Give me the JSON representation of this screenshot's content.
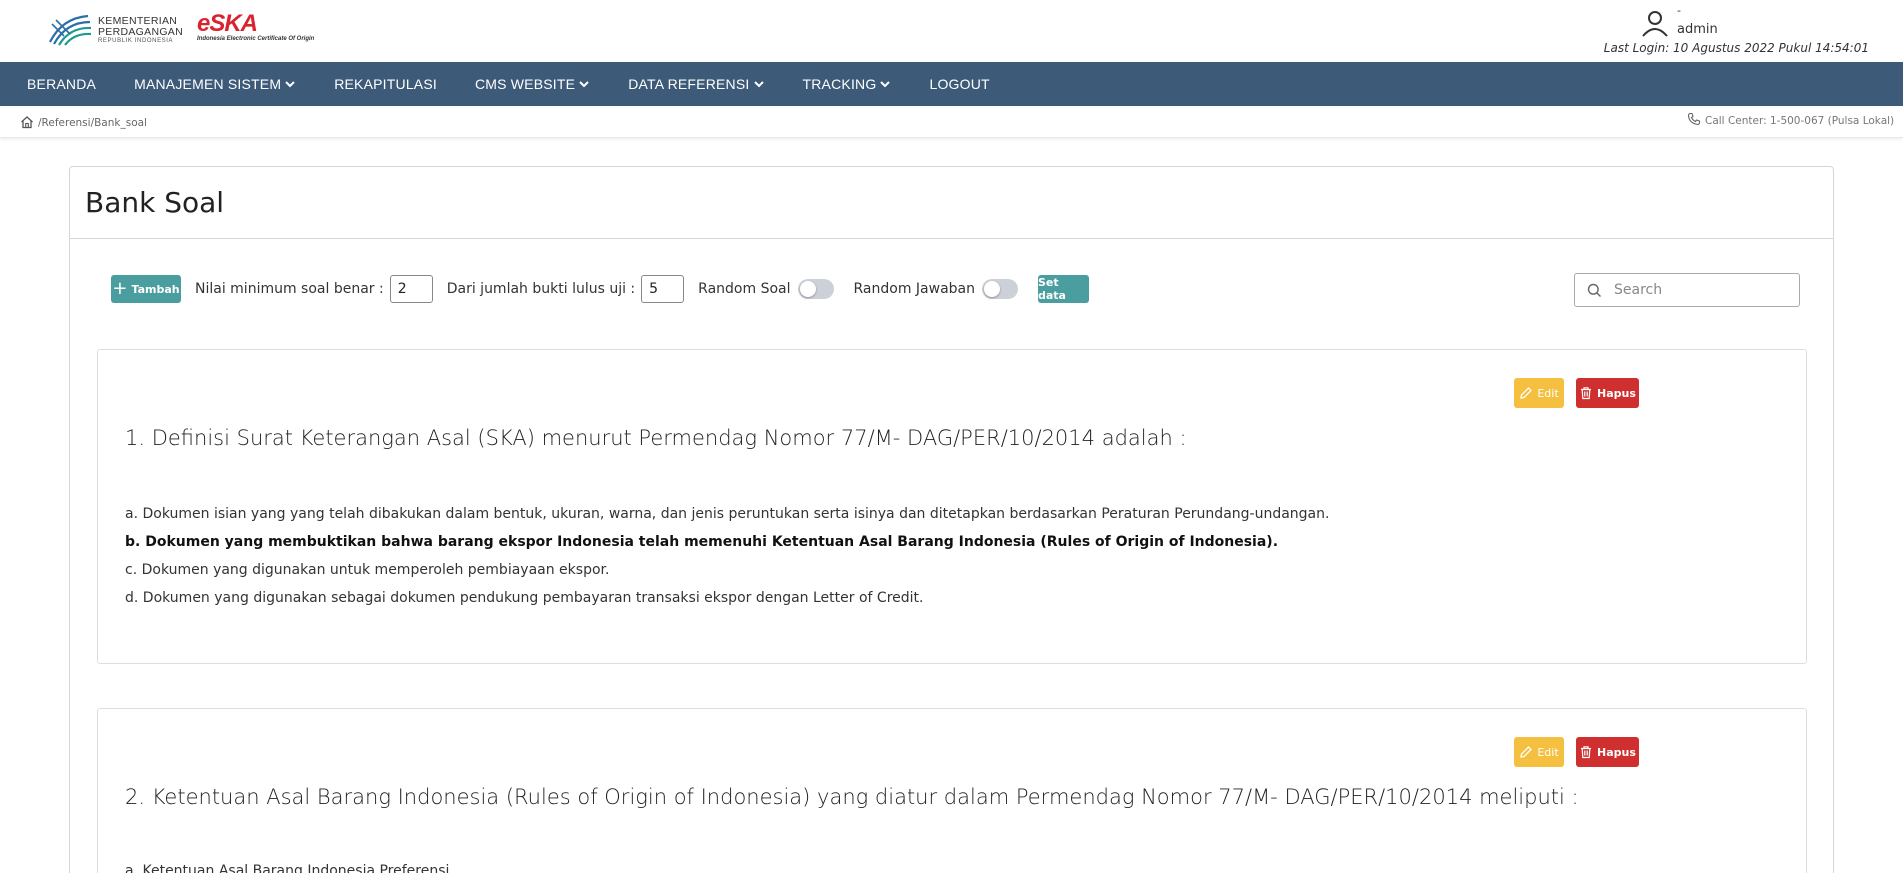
{
  "header": {
    "ministry_line1": "KEMENTERIAN",
    "ministry_line2": "PERDAGANGAN",
    "ministry_line3": "REPUBLIK INDONESIA",
    "brand": "eSKA",
    "brand_tagline": "Indonesia Electronic Certificate Of Origin",
    "user_dash": "-",
    "user_name": "admin",
    "last_login": "Last Login: 10 Agustus 2022 Pukul 14:54:01"
  },
  "nav": {
    "items": [
      {
        "label": "BERANDA",
        "dropdown": false
      },
      {
        "label": "MANAJEMEN SISTEM",
        "dropdown": true
      },
      {
        "label": "REKAPITULASI",
        "dropdown": false
      },
      {
        "label": "CMS WEBSITE",
        "dropdown": true
      },
      {
        "label": "DATA REFERENSI",
        "dropdown": true
      },
      {
        "label": "TRACKING",
        "dropdown": true
      },
      {
        "label": "LOGOUT",
        "dropdown": false
      }
    ]
  },
  "breadcrumb": {
    "path": "/Referensi/Bank_soal",
    "call_center": "Call Center: 1-500-067 (Pulsa Lokal)"
  },
  "page": {
    "title": "Bank Soal"
  },
  "toolbar": {
    "add_label": "Tambah",
    "min_correct_label": "Nilai minimum soal benar :",
    "min_correct_value": "2",
    "total_label": "Dari jumlah bukti lulus uji :",
    "total_value": "5",
    "random_question_label": "Random Soal",
    "random_question_on": false,
    "random_answer_label": "Random Jawaban",
    "random_answer_on": false,
    "set_label": "Set data",
    "search_placeholder": "Search"
  },
  "actions": {
    "edit_label": "Edit",
    "delete_label": "Hapus"
  },
  "questions": [
    {
      "text": "1. Definisi Surat Keterangan Asal (SKA) menurut Permendag Nomor 77/M- DAG/PER/10/2014 adalah :",
      "answers": [
        "a. Dokumen isian yang yang telah dibakukan dalam bentuk, ukuran, warna, dan jenis peruntukan serta isinya dan ditetapkan berdasarkan Peraturan Perundang-undangan.",
        "b. Dokumen yang membuktikan bahwa barang ekspor Indonesia telah memenuhi Ketentuan Asal Barang Indonesia (Rules of Origin of Indonesia).",
        "c. Dokumen yang digunakan untuk memperoleh pembiayaan ekspor.",
        "d. Dokumen yang digunakan sebagai dokumen pendukung pembayaran transaksi ekspor dengan Letter of Credit."
      ],
      "correct_index": 1
    },
    {
      "text": "2. Ketentuan Asal Barang Indonesia (Rules of Origin of Indonesia) yang diatur dalam Permendag Nomor 77/M- DAG/PER/10/2014 meliputi :",
      "answers": [
        "a. Ketentuan Asal Barang Indonesia Preferensi"
      ]
    }
  ],
  "colors": {
    "nav_bg": "#3d5a78",
    "teal_button": "#4b9ea0",
    "edit_button": "#f5c040",
    "delete_button": "#d02f2f",
    "brand_red": "#d9242f"
  }
}
